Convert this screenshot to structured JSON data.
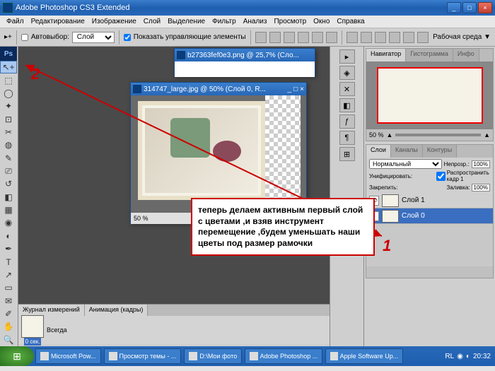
{
  "title": "Adobe Photoshop CS3 Extended",
  "menu": [
    "Файл",
    "Редактирование",
    "Изображение",
    "Слой",
    "Выделение",
    "Фильтр",
    "Анализ",
    "Просмотр",
    "Окно",
    "Справка"
  ],
  "opt": {
    "autoselect_label": "Автовыбор:",
    "autoselect_value": "Слой",
    "showcontrols": "Показать управляющие элементы",
    "workenv": "Рабочая среда ▼"
  },
  "doc1": {
    "title": "b27363fef0e3.png @ 25,7% (Сло..."
  },
  "doc2": {
    "title": "314747_large.jpg @ 50% (Слой 0, R...",
    "zoom": "50 %"
  },
  "nav": {
    "tabs": [
      "Навигатор",
      "Гистограмма",
      "Инфо"
    ],
    "zoom": "50 %"
  },
  "layers": {
    "tabs": [
      "Слои",
      "Каналы",
      "Контуры"
    ],
    "mode": "Нормальный",
    "opacity_label": "Непрозр.:",
    "opacity": "100%",
    "unify": "Унифицировать:",
    "propagate": "Распространить кадр 1",
    "lock": "Закрепить:",
    "fill_label": "Заливка:",
    "fill": "100%",
    "items": [
      {
        "name": "Слой 1",
        "sel": false
      },
      {
        "name": "Слой 0",
        "sel": true
      }
    ]
  },
  "anim": {
    "tabs": [
      "Журнал измерений",
      "Анимация (кадры)"
    ],
    "frame_time": "0 сек.",
    "loop": "Всегда"
  },
  "taskbar": {
    "items": [
      "Microsoft Pow...",
      "Просмотр темы - ...",
      "D:\\Мои фото",
      "Adobe Photoshop ...",
      "Apple Software Up..."
    ],
    "lang": "RL",
    "time": "20:32"
  },
  "annot": "теперь делаем активным первый слой с цветами ,и взяв инструмент перемещение ,будем уменьшать наши цветы под размер рамочки",
  "labels": {
    "a1": "1",
    "a2": "2"
  }
}
